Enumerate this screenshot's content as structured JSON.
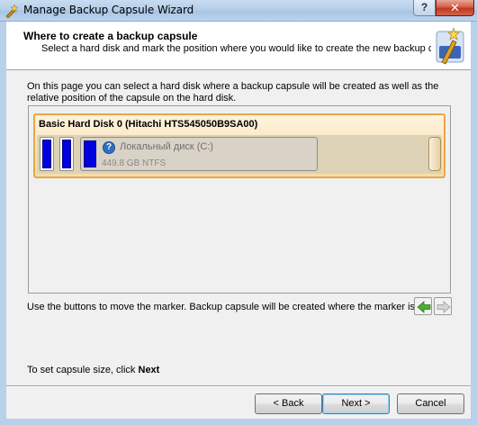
{
  "window": {
    "title": "Manage Backup Capsule Wizard",
    "help_glyph": "?",
    "close_glyph": "✕"
  },
  "header": {
    "title": "Where to create a backup capsule",
    "subtitle": "Select a hard disk and mark the position where you would like to create the new backup capsule."
  },
  "description": "On this page you can select a hard disk where a backup capsule will be created as well as the relative position of the capsule on the hard disk.",
  "disk": {
    "title": "Basic Hard Disk 0 (Hitachi HTS545050B9SA00)",
    "partition": {
      "name": "Локальный диск (C:)",
      "size": "449.8 GB NTFS",
      "icon": "question-icon",
      "icon_glyph": "?"
    }
  },
  "hint": "Use the buttons to move the marker. Backup capsule will be created where the marker is.",
  "footer": {
    "prefix": "To set capsule size, click ",
    "bold": "Next"
  },
  "buttons": {
    "back": "< Back",
    "next": "Next >",
    "cancel": "Cancel"
  },
  "colors": {
    "accent_selected": "#e6a84a",
    "partition_fill": "#0000e0",
    "arrow_green": "#3a9a2a"
  }
}
